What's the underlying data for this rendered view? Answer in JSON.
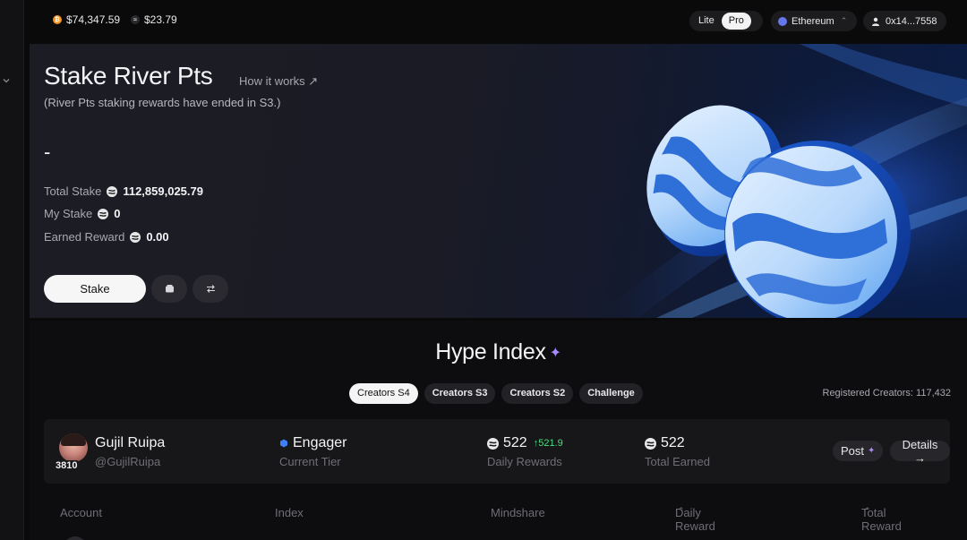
{
  "topbar": {
    "btc_price": "$74,347.59",
    "river_price": "$23.79",
    "mode_options": [
      "Lite",
      "Pro"
    ],
    "mode_selected": "Pro",
    "chain": "Ethereum",
    "wallet": "0x14...7558"
  },
  "hero": {
    "title": "Stake River Pts",
    "how_link": "How it works ↗",
    "subtitle": "(River Pts staking rewards have ended in S3.)",
    "value": "-",
    "stats": [
      {
        "label": "Total Stake",
        "value": "112,859,025.79"
      },
      {
        "label": "My Stake",
        "value": "0"
      },
      {
        "label": "Earned Reward",
        "value": "0.00"
      }
    ],
    "stake_button": "Stake"
  },
  "hype": {
    "title": "Hype Index",
    "tabs": [
      "Creators S4",
      "Creators S3",
      "Creators S2",
      "Challenge"
    ],
    "active_tab": "Creators S4",
    "registered": "Registered Creators: 117,432",
    "profile": {
      "rank": "3810",
      "name": "Gujil Ruipa",
      "handle": "@GujilRuipa",
      "tier": "Engager",
      "tier_label": "Current Tier",
      "daily_rewards": "522",
      "daily_delta": "↑521.9",
      "daily_label": "Daily Rewards",
      "total_earned": "522",
      "total_label": "Total Earned",
      "post_button": "Post",
      "details_button": "Details →"
    },
    "table_headers": {
      "account": "Account",
      "index": "Index",
      "mindshare": "Mindshare",
      "daily_reward": "Daily Reward",
      "total_reward": "Total Reward"
    }
  },
  "colors": {
    "accent_purple": "#a78bfa",
    "delta_green": "#4ade80",
    "btc_orange": "#f7931a",
    "coin_blue": "#3b82f6"
  },
  "icons": [
    "chevron-down-icon",
    "bitcoin-icon",
    "river-icon",
    "ethereum-icon",
    "user-icon",
    "wallet-icon",
    "swap-icon",
    "sparkle-icon",
    "tier-badge-icon",
    "sort-icon"
  ]
}
